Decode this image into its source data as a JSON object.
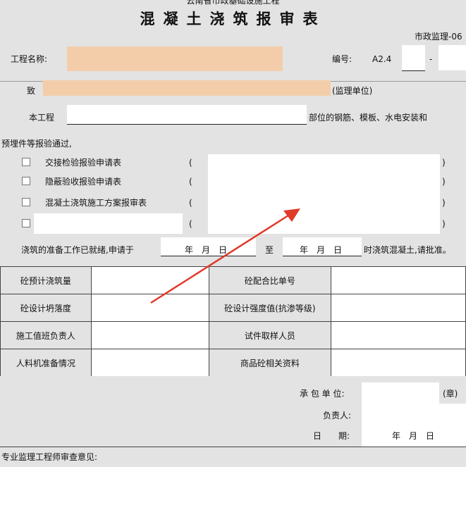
{
  "header": {
    "subtitle": "云南省市政基础设施工程",
    "title": "混凝土浇筑报审表",
    "form_code": "市政监理-06"
  },
  "project": {
    "name_label": "工程名称:",
    "name_value": "",
    "number_label": "编号:",
    "number_value": "A2.4",
    "number_part2": "",
    "number_sep": "-",
    "number_part3": ""
  },
  "addressee": {
    "to_label": "致",
    "to_value": "",
    "supervisor_suffix": "(监理单位)"
  },
  "body": {
    "project_label": "本工程",
    "project_part_value": "",
    "part_suffix": "部位的钢筋、模板、水电安装和",
    "embedded_line": "预埋件等报验通过,",
    "checklist": [
      {
        "label": "交接检验报验申请表",
        "paren_open": "(",
        "value": "",
        "paren_close": ")"
      },
      {
        "label": "隐蔽验收报验申请表",
        "paren_open": "(",
        "value": "",
        "paren_close": ")"
      },
      {
        "label": "混凝土浇筑施工方案报审表",
        "paren_open": "(",
        "value": "",
        "paren_close": ")"
      },
      {
        "label": "",
        "paren_open": "(",
        "value": "",
        "paren_close": ")"
      }
    ],
    "ready_text": "浇筑的准备工作已就绪,申请于",
    "date_from": "年　月　日",
    "to_word": "至",
    "date_to": "年　月　日",
    "request_suffix": "时浇筑混凝土,请批准。"
  },
  "table": {
    "rows": [
      {
        "l1": "砼预计浇筑量",
        "v1": "",
        "l2": "砼配合比单号",
        "v2": ""
      },
      {
        "l1": "砼设计坍落度",
        "v1": "",
        "l2": "砼设计强度值(抗渗等级)",
        "v2": ""
      },
      {
        "l1": "施工值班负责人",
        "v1": "",
        "l2": "试件取样人员",
        "v2": ""
      },
      {
        "l1": "人料机准备情况",
        "v1": "",
        "l2": "商品砼相关资料",
        "v2": ""
      }
    ]
  },
  "signature": {
    "contractor_label": "承 包 单 位:",
    "contractor_value": "",
    "seal": "(章)",
    "responsible_label": "负责人:",
    "date_label": "日　　期:",
    "date_value": "年　月　日"
  },
  "review": {
    "label": "专业监理工程师审查意见:"
  },
  "colors": {
    "gray_bg": "#e3e3e3",
    "highlight_field": "#f3cdaa",
    "annotation_arrow": "#e03a2a"
  }
}
